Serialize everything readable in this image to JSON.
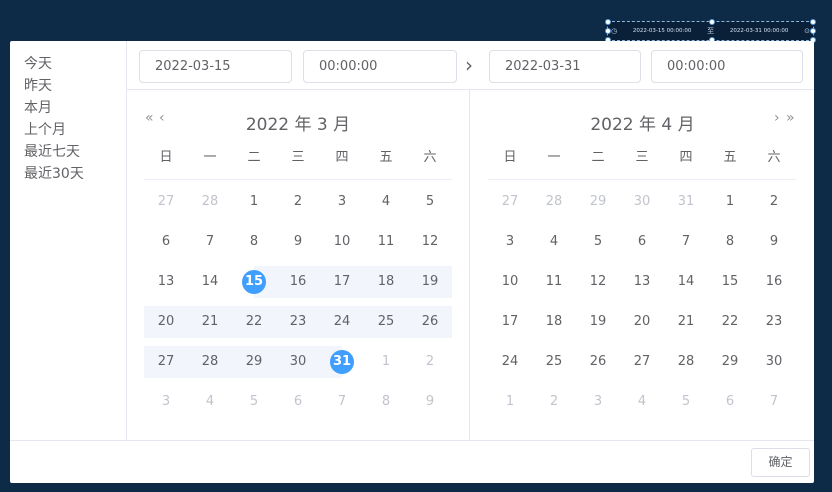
{
  "mini_input": {
    "start": "2022-03-15 00:00:00",
    "separator": "至",
    "end": "2022-03-31 00:00:00"
  },
  "sidebar": {
    "items": [
      {
        "label": "今天"
      },
      {
        "label": "昨天"
      },
      {
        "label": "本月"
      },
      {
        "label": "上个月"
      },
      {
        "label": "最近七天"
      },
      {
        "label": "最近30天"
      }
    ]
  },
  "header": {
    "start_date": "2022-03-15",
    "start_time": "00:00:00",
    "end_date": "2022-03-31",
    "end_time": "00:00:00",
    "separator": "›"
  },
  "weekdays": [
    "日",
    "一",
    "二",
    "三",
    "四",
    "五",
    "六"
  ],
  "left_calendar": {
    "title": "2022 年 3 月",
    "prev_year": "«",
    "prev_month": "‹",
    "rows": [
      [
        {
          "d": "27",
          "m": 1
        },
        {
          "d": "28",
          "m": 1
        },
        {
          "d": "1"
        },
        {
          "d": "2"
        },
        {
          "d": "3"
        },
        {
          "d": "4"
        },
        {
          "d": "5"
        }
      ],
      [
        {
          "d": "6"
        },
        {
          "d": "7"
        },
        {
          "d": "8"
        },
        {
          "d": "9"
        },
        {
          "d": "10"
        },
        {
          "d": "11"
        },
        {
          "d": "12"
        }
      ],
      [
        {
          "d": "13"
        },
        {
          "d": "14"
        },
        {
          "d": "15",
          "s": "start"
        },
        {
          "d": "16",
          "r": 1
        },
        {
          "d": "17",
          "r": 1
        },
        {
          "d": "18",
          "r": 1
        },
        {
          "d": "19",
          "r": 1
        }
      ],
      [
        {
          "d": "20",
          "r": 1
        },
        {
          "d": "21",
          "r": 1
        },
        {
          "d": "22",
          "r": 1
        },
        {
          "d": "23",
          "r": 1
        },
        {
          "d": "24",
          "r": 1
        },
        {
          "d": "25",
          "r": 1
        },
        {
          "d": "26",
          "r": 1
        }
      ],
      [
        {
          "d": "27",
          "r": 1
        },
        {
          "d": "28",
          "r": 1
        },
        {
          "d": "29",
          "r": 1
        },
        {
          "d": "30",
          "r": 1
        },
        {
          "d": "31",
          "s": "end"
        },
        {
          "d": "1",
          "m": 1
        },
        {
          "d": "2",
          "m": 1
        }
      ],
      [
        {
          "d": "3",
          "m": 1
        },
        {
          "d": "4",
          "m": 1
        },
        {
          "d": "5",
          "m": 1
        },
        {
          "d": "6",
          "m": 1
        },
        {
          "d": "7",
          "m": 1
        },
        {
          "d": "8",
          "m": 1
        },
        {
          "d": "9",
          "m": 1
        }
      ]
    ]
  },
  "right_calendar": {
    "title": "2022 年 4 月",
    "next_month": "›",
    "next_year": "»",
    "rows": [
      [
        {
          "d": "27",
          "m": 1
        },
        {
          "d": "28",
          "m": 1
        },
        {
          "d": "29",
          "m": 1
        },
        {
          "d": "30",
          "m": 1
        },
        {
          "d": "31",
          "m": 1
        },
        {
          "d": "1"
        },
        {
          "d": "2"
        }
      ],
      [
        {
          "d": "3"
        },
        {
          "d": "4"
        },
        {
          "d": "5"
        },
        {
          "d": "6"
        },
        {
          "d": "7"
        },
        {
          "d": "8"
        },
        {
          "d": "9"
        }
      ],
      [
        {
          "d": "10"
        },
        {
          "d": "11"
        },
        {
          "d": "12"
        },
        {
          "d": "13"
        },
        {
          "d": "14"
        },
        {
          "d": "15"
        },
        {
          "d": "16"
        }
      ],
      [
        {
          "d": "17"
        },
        {
          "d": "18"
        },
        {
          "d": "19"
        },
        {
          "d": "20"
        },
        {
          "d": "21"
        },
        {
          "d": "22"
        },
        {
          "d": "23"
        }
      ],
      [
        {
          "d": "24"
        },
        {
          "d": "25"
        },
        {
          "d": "26"
        },
        {
          "d": "27"
        },
        {
          "d": "28"
        },
        {
          "d": "29"
        },
        {
          "d": "30"
        }
      ],
      [
        {
          "d": "1",
          "m": 1
        },
        {
          "d": "2",
          "m": 1
        },
        {
          "d": "3",
          "m": 1
        },
        {
          "d": "4",
          "m": 1
        },
        {
          "d": "5",
          "m": 1
        },
        {
          "d": "6",
          "m": 1
        },
        {
          "d": "7",
          "m": 1
        }
      ]
    ]
  },
  "footer": {
    "confirm_label": "确定"
  },
  "colors": {
    "accent": "#409eff",
    "range_bg": "#f2f6fc",
    "backdrop": "#0d2a47"
  }
}
